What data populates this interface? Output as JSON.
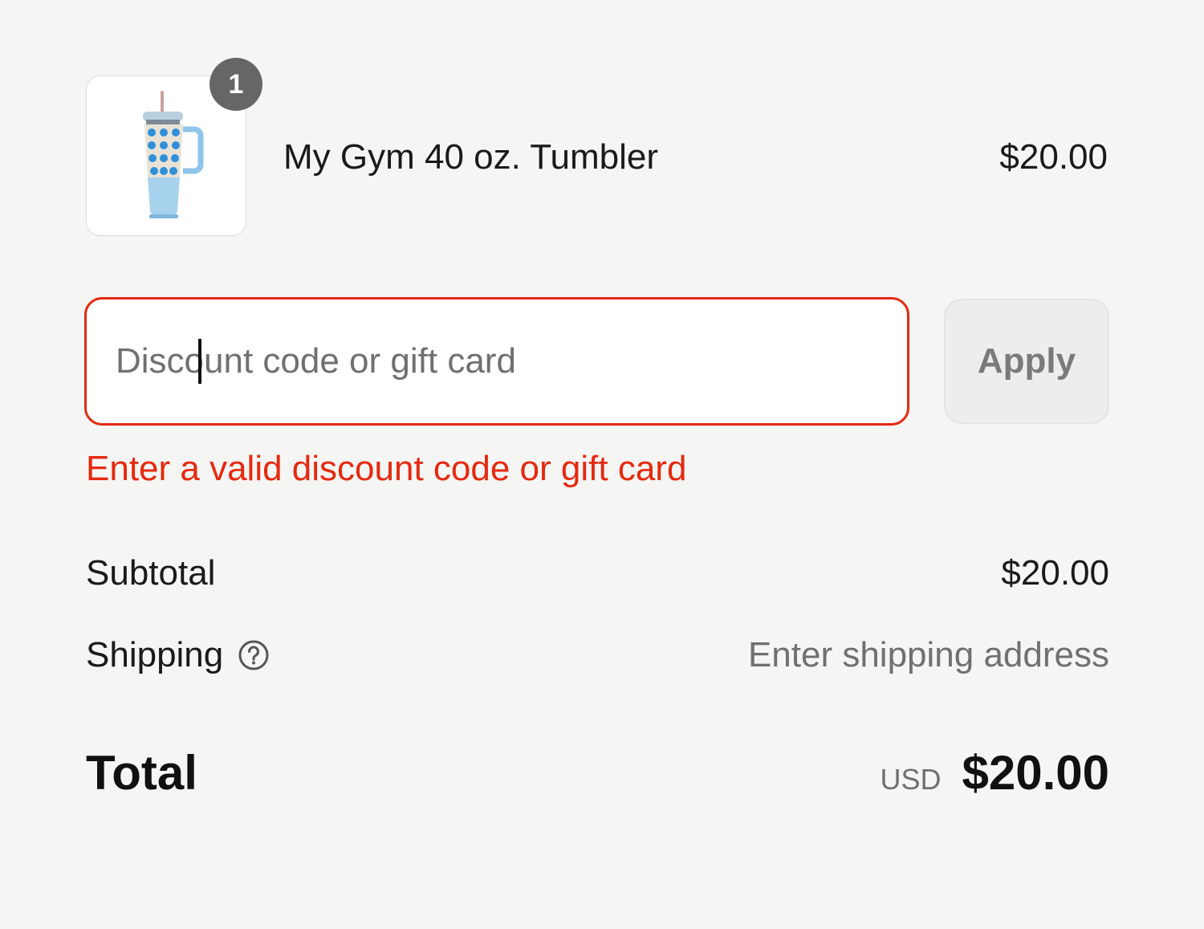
{
  "cart": {
    "items": [
      {
        "quantity": "1",
        "name": "My Gym 40 oz. Tumbler",
        "price": "$20.00",
        "image_icon": "tumbler-product-image"
      }
    ]
  },
  "discount": {
    "placeholder": "Discount code or gift card",
    "value": "",
    "apply_label": "Apply",
    "error_message": "Enter a valid discount code or gift card"
  },
  "summary": {
    "subtotal_label": "Subtotal",
    "subtotal_value": "$20.00",
    "shipping_label": "Shipping",
    "shipping_help_icon": "question-circle-icon",
    "shipping_value": "Enter shipping address",
    "total_label": "Total",
    "currency": "USD",
    "total_value": "$20.00"
  },
  "colors": {
    "background": "#f5f5f3",
    "error": "#e52910",
    "muted_text": "#707070",
    "badge": "#666666"
  }
}
